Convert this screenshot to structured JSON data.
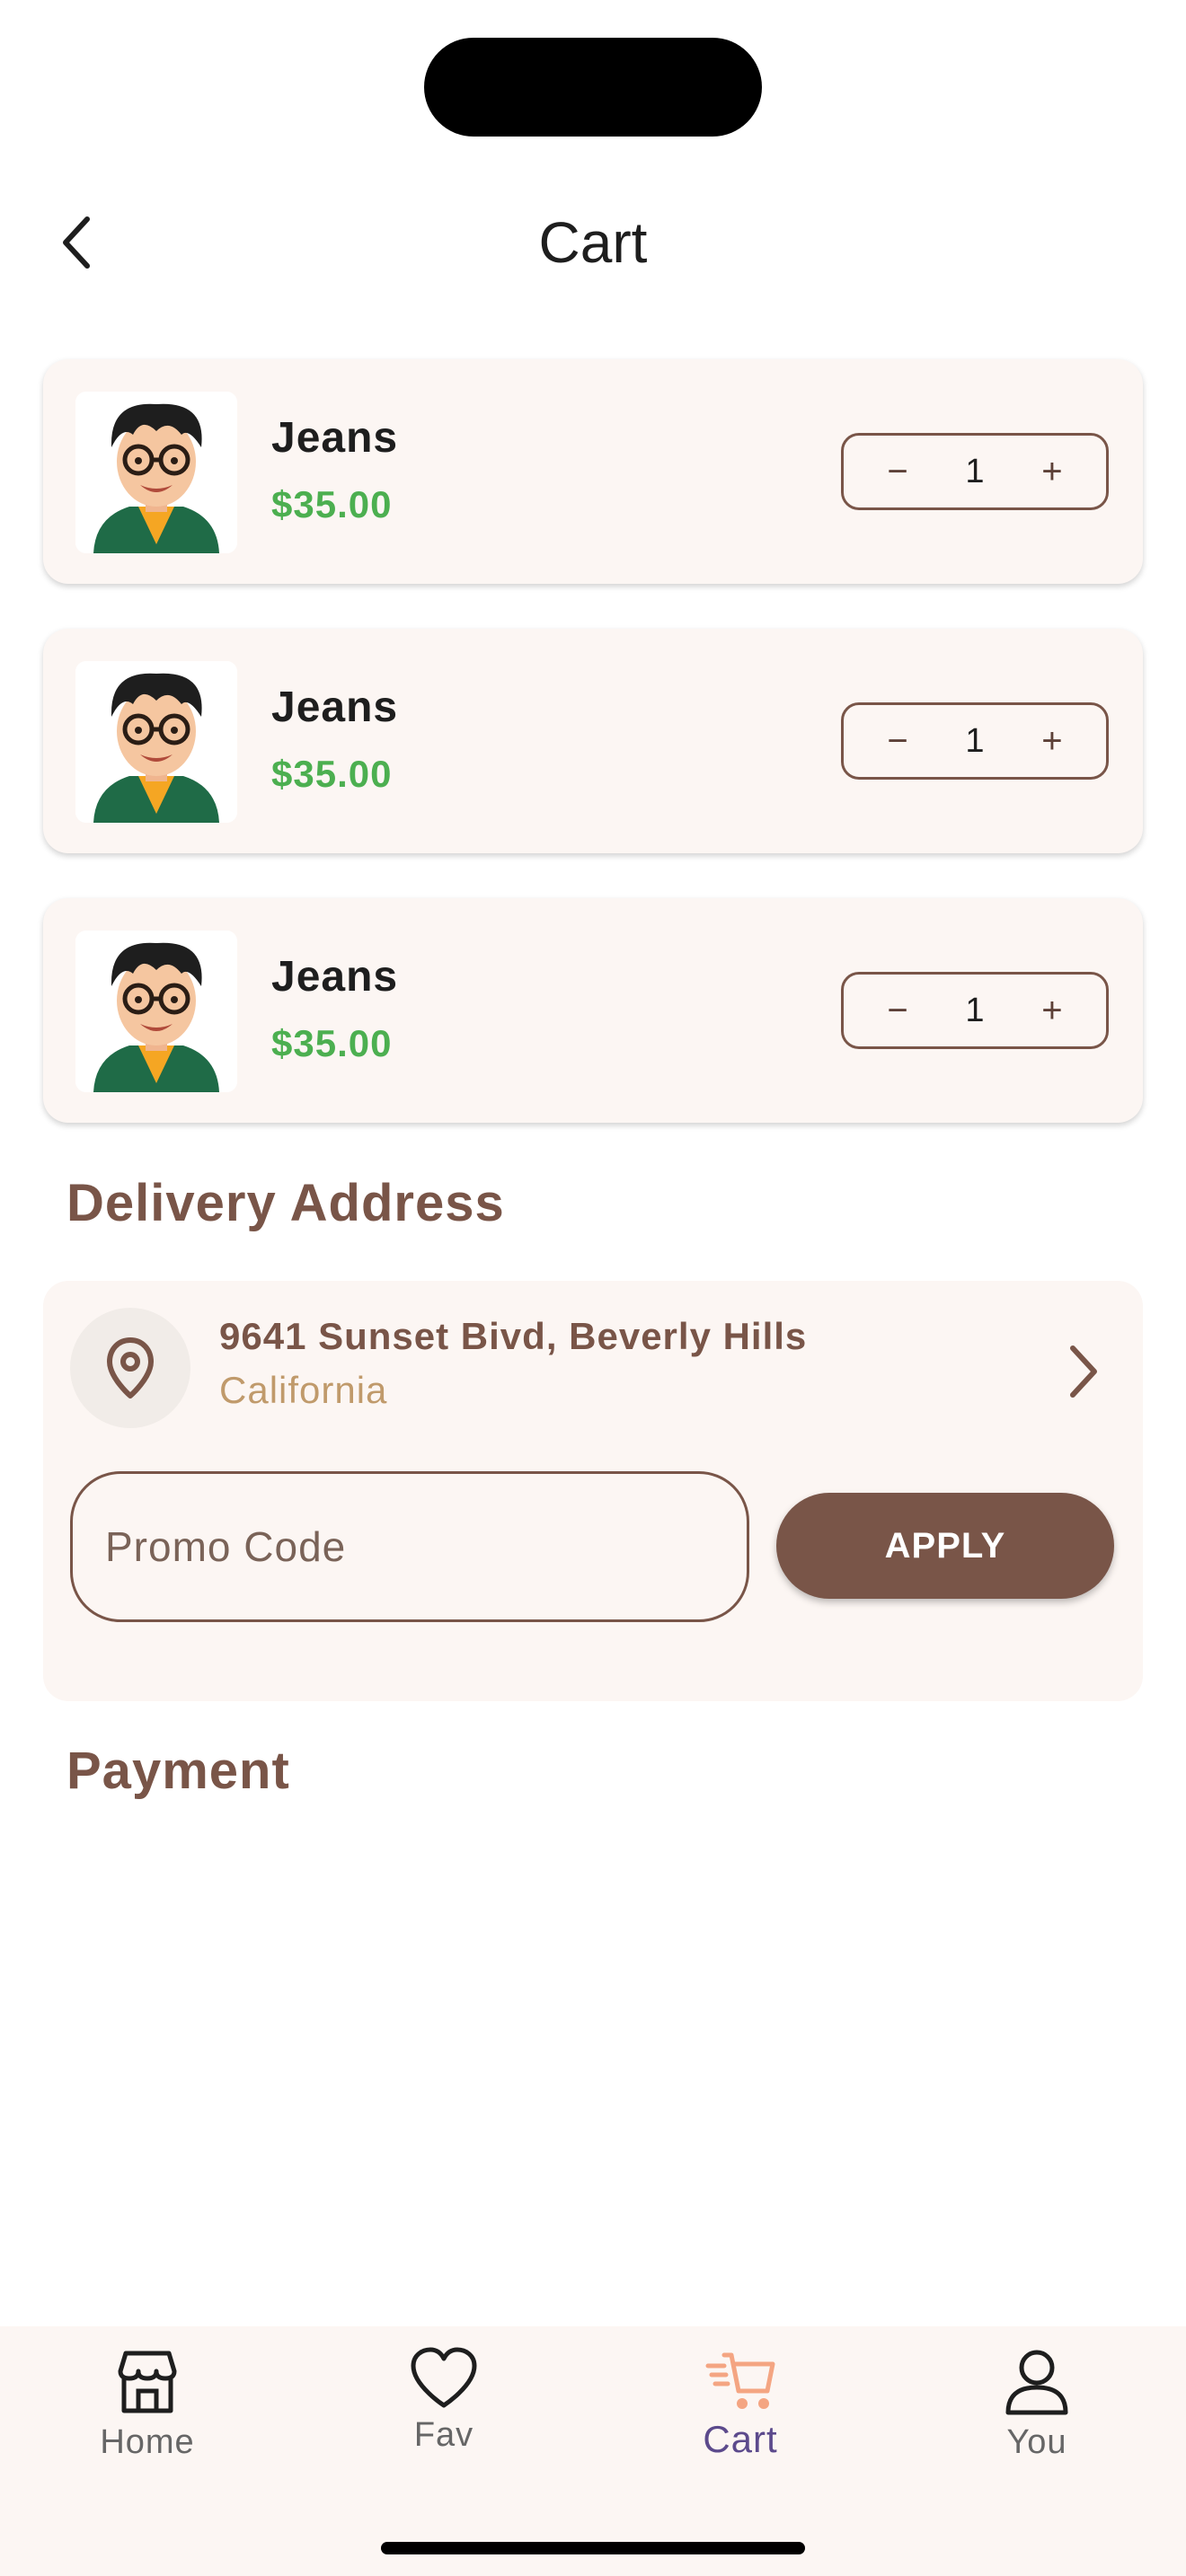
{
  "header": {
    "title": "Cart"
  },
  "cart": {
    "items": [
      {
        "name": "Jeans",
        "price": "$35.00",
        "quantity": "1"
      },
      {
        "name": "Jeans",
        "price": "$35.00",
        "quantity": "1"
      },
      {
        "name": "Jeans",
        "price": "$35.00",
        "quantity": "1"
      }
    ]
  },
  "delivery": {
    "section_title": "Delivery Address",
    "address_line1": "9641 Sunset Bivd, Beverly Hills",
    "address_line2": "California"
  },
  "promo": {
    "placeholder": "Promo Code",
    "apply_label": "APPLY"
  },
  "payment": {
    "section_title": "Payment"
  },
  "bottom_nav": {
    "items": [
      {
        "label": "Home",
        "icon": "store-icon"
      },
      {
        "label": "Fav",
        "icon": "heart-icon"
      },
      {
        "label": "Cart",
        "icon": "cart-icon",
        "active": true
      },
      {
        "label": "You",
        "icon": "user-icon"
      }
    ]
  },
  "colors": {
    "accent_brown": "#795548",
    "price_green": "#4caf50",
    "card_bg": "#fcf6f3",
    "active_nav_icon": "#f4a582",
    "active_nav_label": "#5c4a8c"
  }
}
